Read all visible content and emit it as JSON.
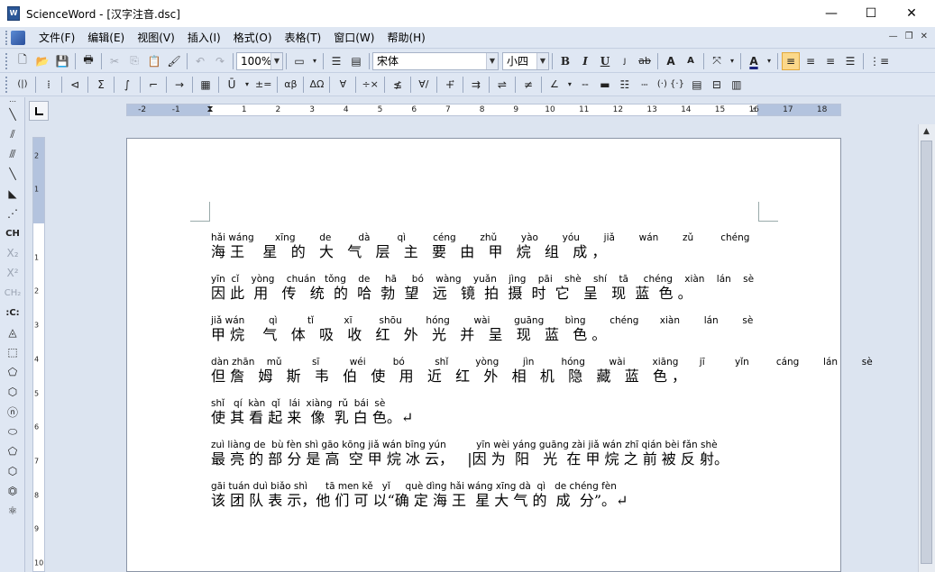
{
  "window": {
    "title": "ScienceWord - [汉字注音.dsc]",
    "minimize": "—",
    "maximize": "☐",
    "close": "✕",
    "icon": "app-icon"
  },
  "menu": [
    {
      "label": "文件(F)"
    },
    {
      "label": "编辑(E)"
    },
    {
      "label": "视图(V)"
    },
    {
      "label": "插入(I)"
    },
    {
      "label": "格式(O)"
    },
    {
      "label": "表格(T)"
    },
    {
      "label": "窗口(W)"
    },
    {
      "label": "帮助(H)"
    }
  ],
  "mdi": {
    "min": "—",
    "restore": "❐",
    "close": "✕"
  },
  "toolbar1": {
    "zoom": "100%",
    "font": "宋体",
    "font_size": "小四",
    "bold": "B",
    "italic": "I",
    "underline": "U",
    "strike": "ab",
    "grow": "A",
    "shrink": "A",
    "font_color": "A"
  },
  "toolbar2": {
    "paren": "(|)",
    "sigma": "Σ",
    "plusminus": "±=",
    "alphabeta": "αβ",
    "omega": "ΔΩ",
    "angle": "∠",
    "lessthan": "∀",
    "cross": "÷×",
    "approx": "∀/",
    "arrows": "⇌",
    "parens": "(·) {·}"
  },
  "ruler": {
    "h_ticks": [
      "-2",
      "-1",
      "",
      "1",
      "2",
      "3",
      "4",
      "5",
      "6",
      "7",
      "8",
      "9",
      "10",
      "11",
      "12",
      "13",
      "14",
      "15",
      "16",
      "17",
      "18"
    ],
    "v_ticks": [
      "2",
      "1",
      "",
      "1",
      "2",
      "3",
      "4",
      "5",
      "6",
      "7",
      "8",
      "9",
      "10"
    ]
  },
  "lefttools": {
    "ch": "CH",
    "x2sub": "X₂",
    "x2sup": "X²",
    "ch2": "CH₂",
    "c": ":C:"
  },
  "document": {
    "paragraphs": [
      {
        "pinyin": "hǎi wáng       xīng        de         dà         qì         céng        zhǔ        yào        yóu        jiǎ        wán        zǔ         chéng",
        "hanzi": "海 王    星   的   大   气   层   主   要   由   甲   烷   组   成 ，"
      },
      {
        "pinyin": "yīn  cǐ    yòng    chuán   tǒng    de     hā     bó    wàng    yuǎn    jìng    pāi    shè    shí    tā     chéng    xiàn    lán    sè",
        "hanzi": "因 此  用   传   统  的  哈  勃  望   远   镜  拍  摄  时  它   呈   现  蓝  色 。"
      },
      {
        "pinyin": "jiǎ wán        qì          tǐ          xī         shōu        hóng        wài        guāng       bìng        chéng       xiàn        lán        sè",
        "hanzi": "甲 烷    气   体   吸   收   红   外   光   并   呈   现   蓝   色 。"
      },
      {
        "pinyin": "dàn zhān    mǔ          sī          wéi         bó          shǐ         yòng        jìn         hóng        wài         xiāng       jī          yǐn         cáng        lán        sè",
        "hanzi": "但 詹   姆   斯   韦   伯   使   用   近   红   外   相   机   隐   藏   蓝   色 ，"
      },
      {
        "pinyin": "shǐ   qí  kàn  qǐ   lái  xiàng  rǔ  bái  sè",
        "hanzi": "使 其 看 起 来  像  乳 白 色。↵"
      },
      {
        "pinyin": "zuì liàng de  bù fèn shì gāo kōng jiǎ wán bīng yún          yīn wèi yáng guāng zài jiǎ wán zhī qián bèi fǎn shè",
        "hanzi": "最 亮 的 部 分 是 高  空 甲 烷 冰 云，   |因 为  阳   光  在 甲 烷 之 前 被 反 射。"
      },
      {
        "pinyin": "gāi tuán duì biǎo shì      tā men kě   yǐ     què dìng hǎi wáng xīng dà  qì   de chéng fèn",
        "hanzi": "该 团 队 表 示，他 们 可 以“确 定 海 王  星 大 气 的  成  分”。↵"
      }
    ]
  }
}
